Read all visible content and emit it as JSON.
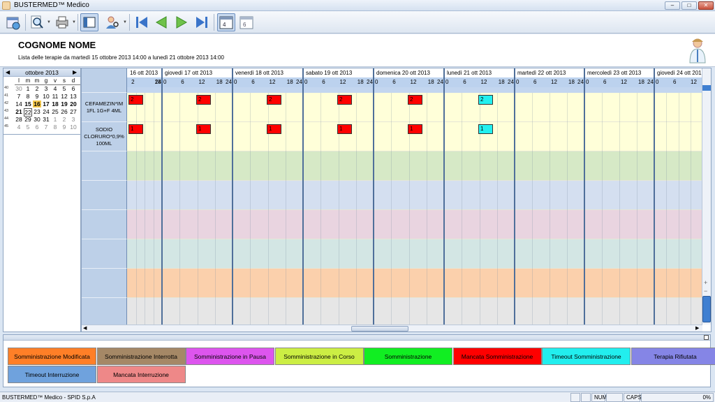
{
  "window": {
    "title": "BUSTERMED™ Medico",
    "minimize": "–",
    "maximize": "□",
    "close": "✕"
  },
  "toolbar": {
    "icons": [
      "calendar-refresh-icon",
      "magnifier-icon",
      "printer-icon",
      "layout-panel-icon",
      "user-search-icon",
      "first-page-icon",
      "previous-page-icon",
      "next-page-icon",
      "last-page-icon",
      "calendar-week-icon",
      "calendar-day-icon"
    ],
    "week_badge": "4",
    "day_badge": "6"
  },
  "patient": {
    "name": "COGNOME NOME",
    "subtitle": "Lista delle terapie da martedì 15 ottobre 2013 14:00 a lunedì 21 ottobre 2013 14:00"
  },
  "calendar": {
    "month_label": "ottobre 2013",
    "weekday_headers": [
      "l",
      "m",
      "m",
      "g",
      "v",
      "s",
      "d"
    ],
    "rows": [
      {
        "week": "40",
        "days": [
          "30",
          "1",
          "2",
          "3",
          "4",
          "5",
          "6"
        ]
      },
      {
        "week": "41",
        "days": [
          "7",
          "8",
          "9",
          "10",
          "11",
          "12",
          "13"
        ]
      },
      {
        "week": "42",
        "days": [
          "14",
          "15",
          "16",
          "17",
          "18",
          "19",
          "20"
        ]
      },
      {
        "week": "43",
        "days": [
          "21",
          "22",
          "23",
          "24",
          "25",
          "26",
          "27"
        ]
      },
      {
        "week": "44",
        "days": [
          "28",
          "29",
          "30",
          "31",
          "1",
          "2",
          "3"
        ]
      },
      {
        "week": "45",
        "days": [
          "4",
          "5",
          "6",
          "7",
          "8",
          "9",
          "10"
        ]
      }
    ],
    "today": "16",
    "selected": "22"
  },
  "therapies": [
    {
      "name": "CEFAMEZIN*IM 1FL 1G+F 4ML"
    },
    {
      "name": "SODIO CLORURO*0,9% 100ML"
    }
  ],
  "timeline": {
    "days": [
      "16 ott 2013",
      "giovedì 17 ott 2013",
      "venerdì 18 ott 2013",
      "sabato 19 ott 2013",
      "domenica 20 ott 2013",
      "lunedì 21 ott 2013",
      "martedì 22 ott 2013",
      "mercoledì 23 ott 2013",
      "giovedì 24 ott 2013"
    ],
    "hours_first": [
      "2",
      "18",
      "24"
    ],
    "hours": [
      "0",
      "6",
      "12",
      "18",
      "24"
    ],
    "hours_last": [
      "0",
      "6",
      "12"
    ]
  },
  "administrations": [
    {
      "row": 0,
      "day": 0,
      "label": "2",
      "status": "Mancata Somministrazione",
      "color": "#ff0000"
    },
    {
      "row": 0,
      "day": 1,
      "label": "2",
      "status": "Mancata Somministrazione",
      "color": "#ff0000"
    },
    {
      "row": 0,
      "day": 2,
      "label": "2",
      "status": "Mancata Somministrazione",
      "color": "#ff0000"
    },
    {
      "row": 0,
      "day": 3,
      "label": "2",
      "status": "Mancata Somministrazione",
      "color": "#ff0000"
    },
    {
      "row": 0,
      "day": 4,
      "label": "2",
      "status": "Mancata Somministrazione",
      "color": "#ff0000"
    },
    {
      "row": 0,
      "day": 5,
      "label": "2",
      "status": "Timeout Somministrazione",
      "color": "#22f0f0"
    },
    {
      "row": 1,
      "day": 0,
      "label": "1",
      "status": "Mancata Somministrazione",
      "color": "#ff0000"
    },
    {
      "row": 1,
      "day": 1,
      "label": "1",
      "status": "Mancata Somministrazione",
      "color": "#ff0000"
    },
    {
      "row": 1,
      "day": 2,
      "label": "1",
      "status": "Mancata Somministrazione",
      "color": "#ff0000"
    },
    {
      "row": 1,
      "day": 3,
      "label": "1",
      "status": "Mancata Somministrazione",
      "color": "#ff0000"
    },
    {
      "row": 1,
      "day": 4,
      "label": "1",
      "status": "Mancata Somministrazione",
      "color": "#ff0000"
    },
    {
      "row": 1,
      "day": 5,
      "label": "1",
      "status": "Timeout Somministrazione",
      "color": "#22f0f0"
    }
  ],
  "band_colors": [
    "#ffffd9",
    "#ffffd9",
    "#d6e9c6",
    "#d4dff0",
    "#e9d4e0",
    "#d3e6e4",
    "#fbd0ac",
    "#e6e6e6"
  ],
  "legend": [
    {
      "label": "Somministrazione Modificata",
      "color": "#ff7f27"
    },
    {
      "label": "Somministrazione Interrotta",
      "color": "#a58866"
    },
    {
      "label": "Somministrazione in Pausa",
      "color": "#dd55ee"
    },
    {
      "label": "Somministrazione in Corso",
      "color": "#ccee44"
    },
    {
      "label": "Somministrazione",
      "color": "#11ee22"
    },
    {
      "label": "Mancata Somministrazione",
      "color": "#ff0000"
    },
    {
      "label": "Timeout Somministrazione",
      "color": "#22eeee"
    },
    {
      "label": "Terapia Rifiutata",
      "color": "#8585e6"
    },
    {
      "label": "Timeout Interruzione",
      "color": "#6fa2dd"
    },
    {
      "label": "Mancata Interruzione",
      "color": "#ee8888"
    }
  ],
  "statusbar": {
    "text": "BUSTERMED™ Medico - SPID S.p.A",
    "num": "NUM",
    "caps": "CAPS",
    "progress": "0%"
  }
}
